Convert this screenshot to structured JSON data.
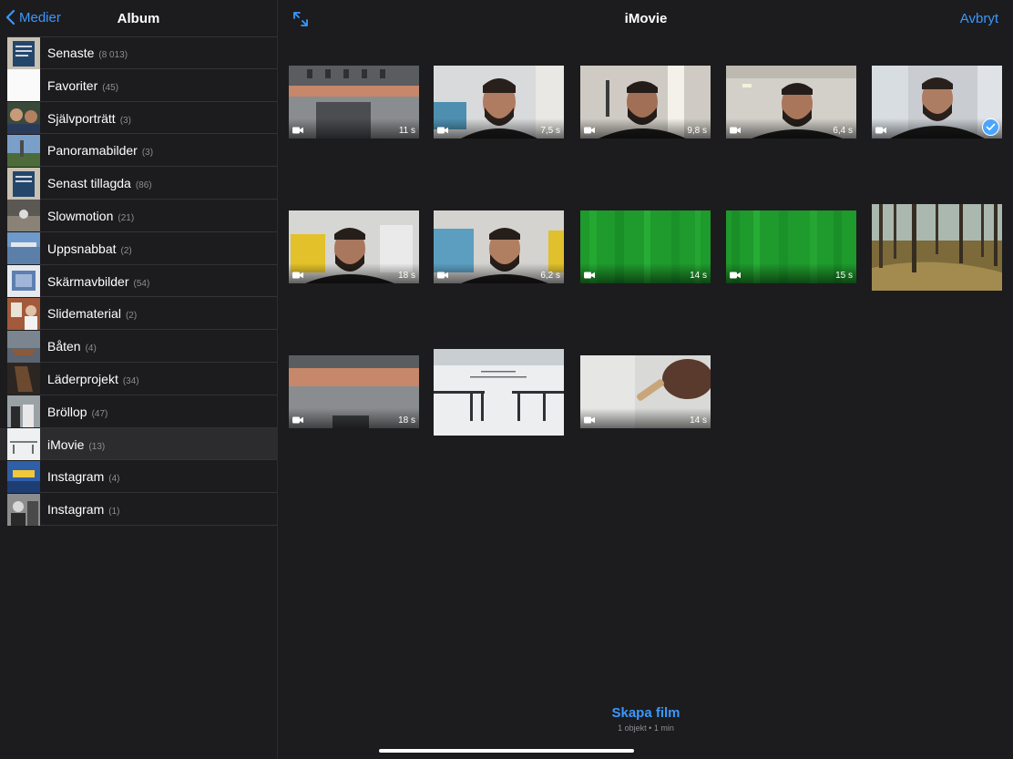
{
  "sidebar": {
    "back_label": "Medier",
    "title": "Album",
    "albums": [
      {
        "label": "Senaste",
        "count": "(8 013)"
      },
      {
        "label": "Favoriter",
        "count": "(45)"
      },
      {
        "label": "Självporträtt",
        "count": "(3)"
      },
      {
        "label": "Panoramabilder",
        "count": "(3)"
      },
      {
        "label": "Senast tillagda",
        "count": "(86)"
      },
      {
        "label": "Slowmotion",
        "count": "(21)"
      },
      {
        "label": "Uppsnabbat",
        "count": "(2)"
      },
      {
        "label": "Skärmavbilder",
        "count": "(54)"
      },
      {
        "label": "Slidematerial",
        "count": "(2)"
      },
      {
        "label": "Båten",
        "count": "(4)"
      },
      {
        "label": "Läderprojekt",
        "count": "(34)"
      },
      {
        "label": "Bröllop",
        "count": "(47)"
      },
      {
        "label": "iMovie",
        "count": "(13)"
      },
      {
        "label": "Instagram",
        "count": "(4)"
      },
      {
        "label": "Instagram",
        "count": "(1)"
      }
    ],
    "selected_album": "iMovie"
  },
  "header": {
    "title": "iMovie",
    "cancel_label": "Avbryt"
  },
  "media": [
    {
      "type": "video",
      "duration": "11 s",
      "scene": "hall",
      "selected": false
    },
    {
      "type": "video",
      "duration": "7,5 s",
      "scene": "face-office",
      "selected": false
    },
    {
      "type": "video",
      "duration": "9,8 s",
      "scene": "face-light",
      "selected": false
    },
    {
      "type": "video",
      "duration": "6,4 s",
      "scene": "face-ceiling",
      "selected": false
    },
    {
      "type": "video",
      "duration": "",
      "scene": "face-window",
      "selected": true
    },
    {
      "type": "video",
      "duration": "18 s",
      "scene": "face-yellow",
      "selected": false
    },
    {
      "type": "video",
      "duration": "6,2 s",
      "scene": "face-poster",
      "selected": false
    },
    {
      "type": "video",
      "duration": "14 s",
      "scene": "green",
      "selected": false
    },
    {
      "type": "video",
      "duration": "15 s",
      "scene": "green",
      "selected": false
    },
    {
      "type": "photo",
      "duration": "",
      "scene": "forest",
      "selected": false
    },
    {
      "type": "video",
      "duration": "18 s",
      "scene": "hall",
      "selected": false
    },
    {
      "type": "photo",
      "duration": "",
      "scene": "snow",
      "selected": false
    },
    {
      "type": "video",
      "duration": "14 s",
      "scene": "hand",
      "selected": false
    }
  ],
  "footer": {
    "create_label": "Skapa film",
    "summary": "1 objekt • 1 min"
  },
  "colors": {
    "accent": "#3a98ff",
    "background": "#1c1c1e",
    "selected_row": "#2c2c2e",
    "check": "#4aa5ff"
  }
}
